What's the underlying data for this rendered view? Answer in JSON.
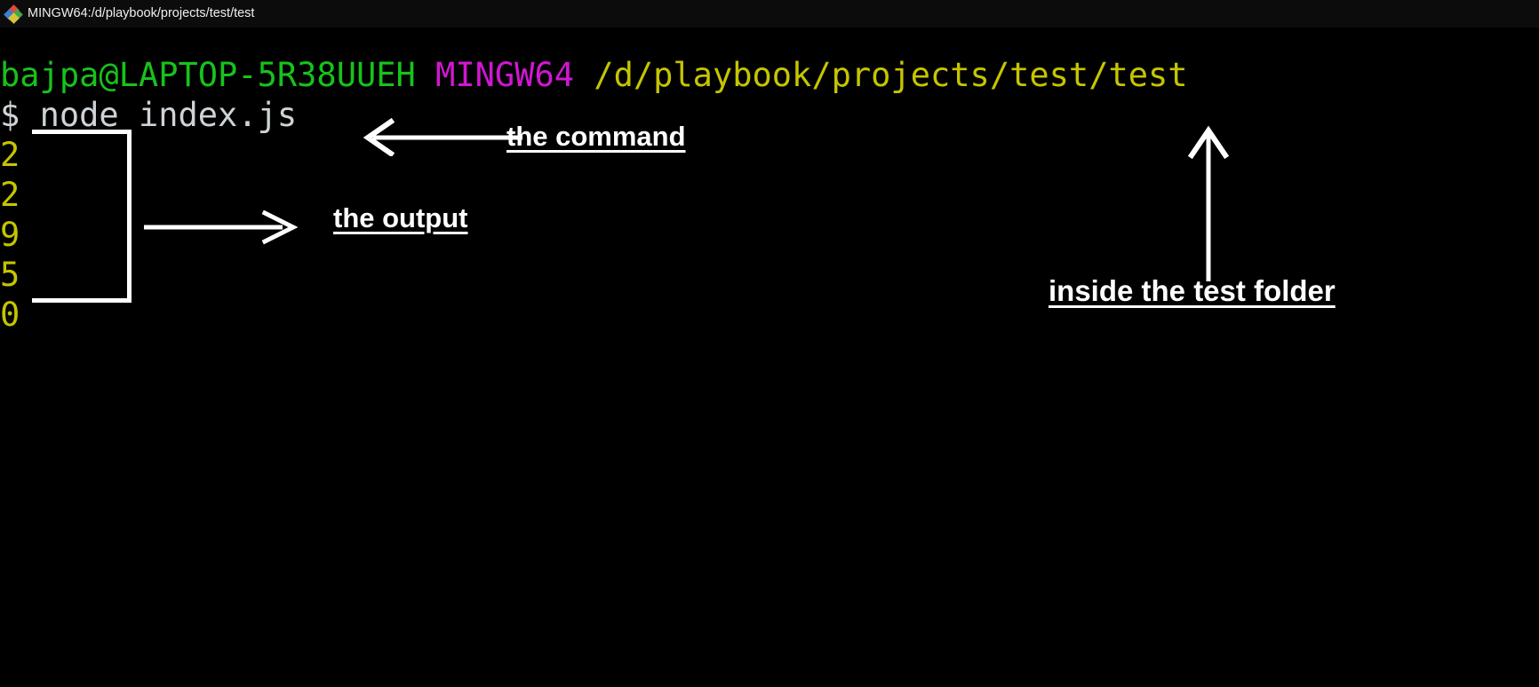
{
  "window": {
    "title": "MINGW64:/d/playbook/projects/test/test",
    "icon": "git-bash-diamond-icon"
  },
  "terminal": {
    "background_color": "#000000",
    "prompt": {
      "user_host": "bajpa@LAPTOP-5R38UUEH",
      "user_host_color": "#17c21c",
      "shell": "MINGW64",
      "shell_color": "#d117d1",
      "path": "/d/playbook/projects/test/test",
      "path_color": "#c5c500",
      "separator_space": " "
    },
    "command_line": {
      "sigil": "$",
      "command": "node index.js",
      "text_color": "#cdd3d6"
    },
    "output": {
      "lines": [
        "2",
        "2",
        "9",
        "5",
        "0"
      ],
      "color": "#c5c500"
    }
  },
  "annotations": {
    "command": {
      "label": "the command",
      "arrow": "left-arrow",
      "color": "#ffffff"
    },
    "output": {
      "label": "the output",
      "arrow": "right-arrow",
      "color": "#ffffff"
    },
    "folder": {
      "label": "inside the test folder",
      "arrow": "up-arrow",
      "color": "#ffffff"
    },
    "bracket": {
      "shape": "right-bracket-outline",
      "color": "#ffffff"
    }
  }
}
